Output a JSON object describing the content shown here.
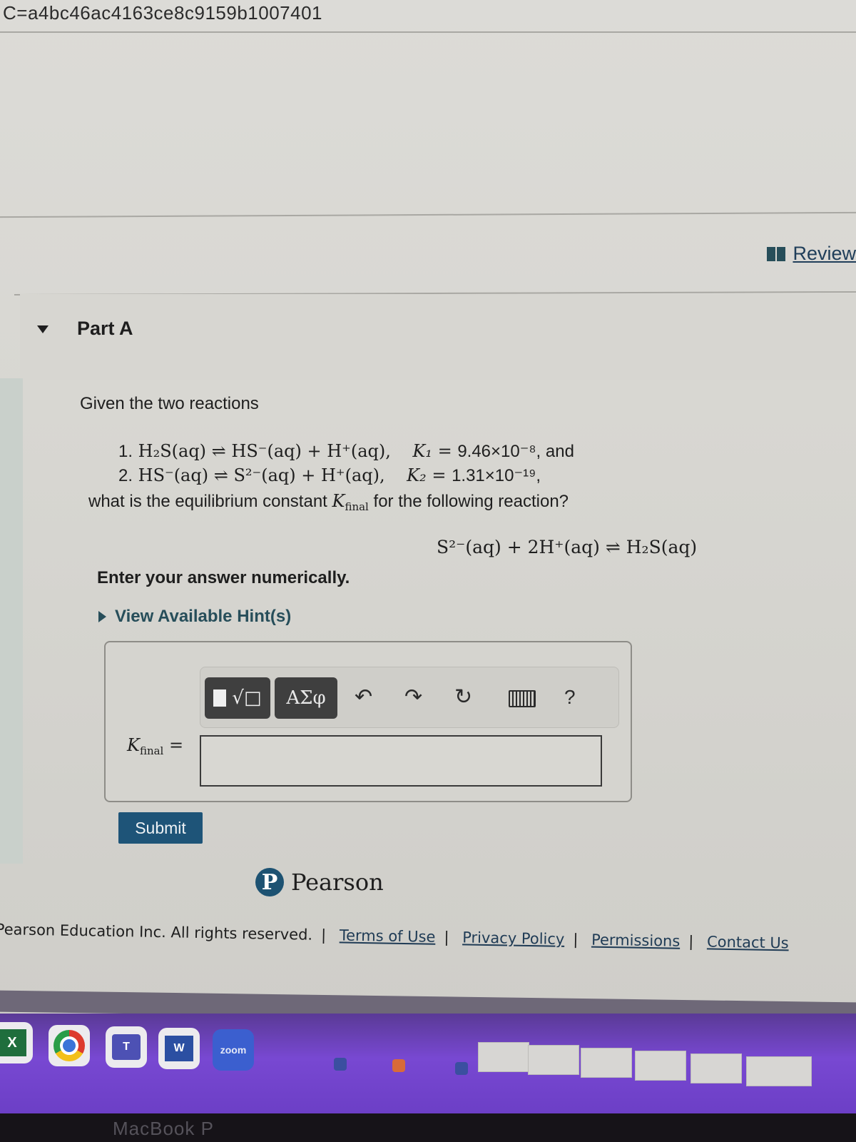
{
  "browser": {
    "url_fragment": "C=a4bc46ac4163ce8c9159b1007401"
  },
  "toolbar_right": {
    "review_label": "Review"
  },
  "part": {
    "title": "Part A",
    "intro": "Given the two reactions",
    "reactions": [
      {
        "num": "1.",
        "lhs": "H₂S(aq)",
        "rhs_a": "HS⁻(aq)",
        "rhs_b": "H⁺(aq),",
        "k_name": "K₁",
        "k_value": "9.46×10⁻⁸",
        "tail": ", and"
      },
      {
        "num": "2.",
        "lhs": "HS⁻(aq)",
        "rhs_a": "S²⁻(aq)",
        "rhs_b": "H⁺(aq),",
        "k_name": "K₂",
        "k_value": "1.31×10⁻¹⁹",
        "tail": ","
      }
    ],
    "question": "what is the equilibrium constant K_final for the following reaction?",
    "question_pre": "what is the equilibrium constant",
    "question_post": "for the following reaction?",
    "target_reaction": "S²⁻(aq) + 2H⁺(aq) ⇌ H₂S(aq)",
    "instruction": "Enter your answer numerically.",
    "hint_label": "View Available Hint(s)"
  },
  "answer": {
    "toolbar": {
      "templates_icon": "templates-icon",
      "greek_label": "ΑΣφ",
      "undo_icon": "undo-icon",
      "redo_icon": "redo-icon",
      "reset_icon": "reset-icon",
      "keyboard_icon": "keyboard-icon",
      "help_label": "?"
    },
    "variable": "K",
    "variable_sub": "final",
    "equals": "=",
    "input_value": "",
    "submit_label": "Submit"
  },
  "brand": {
    "logo_letter": "P",
    "name": "Pearson"
  },
  "footer": {
    "copyright": "Pearson Education Inc. All rights reserved.",
    "links": [
      "Terms of Use",
      "Privacy Policy",
      "Permissions",
      "Contact Us"
    ]
  },
  "dock": {
    "apps": [
      {
        "name": "Excel",
        "glyph": "X"
      },
      {
        "name": "Chrome",
        "glyph": ""
      },
      {
        "name": "Teams",
        "glyph": "T"
      },
      {
        "name": "Word",
        "glyph": "W"
      },
      {
        "name": "Zoom",
        "glyph": "zoom"
      }
    ]
  },
  "device": {
    "label": "MacBook P"
  }
}
